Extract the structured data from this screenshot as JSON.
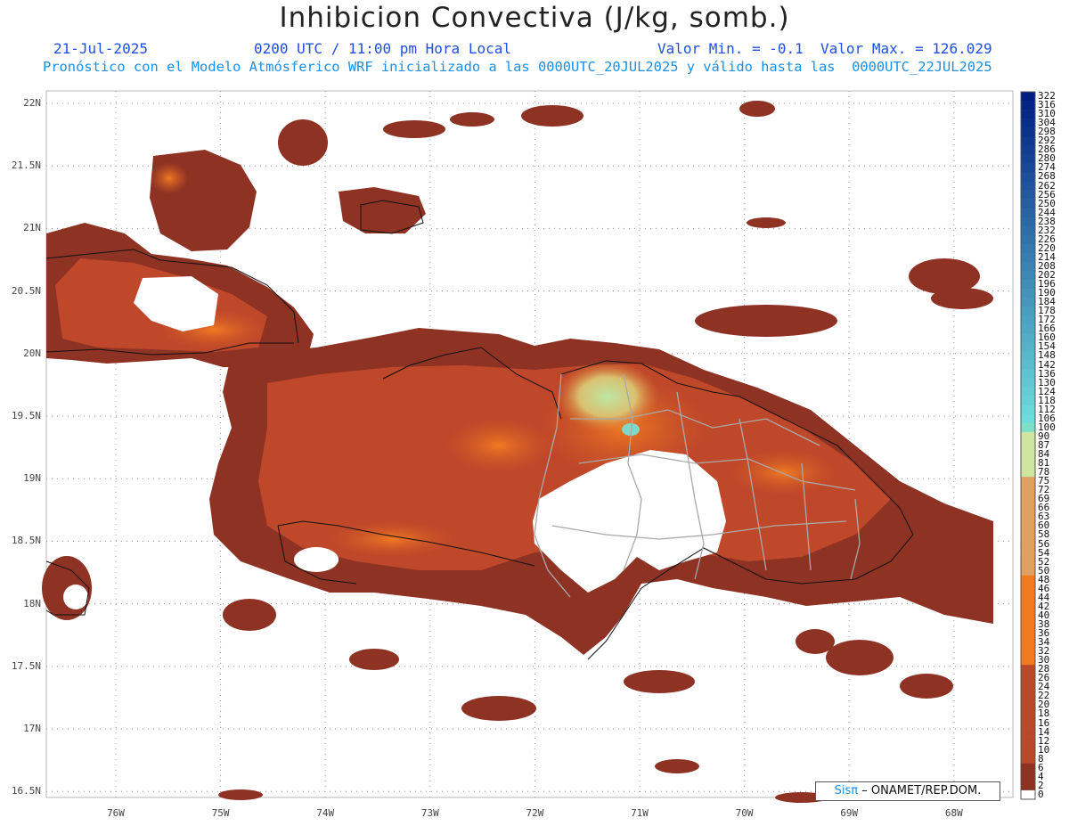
{
  "header": {
    "title": "Inhibicion Convectiva (J/kg, somb.)",
    "date": "21-Jul-2025",
    "time": "0200 UTC / 11:00 pm Hora Local",
    "min_max": "Valor Min. = -0.1  Valor Max. = 126.029",
    "forecast_info": "Pronóstico con el Modelo Atmósferico WRF inicializado a las 0000UTC_20JUL2025 y válido hasta las  0000UTC_22JUL2025"
  },
  "map": {
    "lat_labels": [
      "22N",
      "21.5N",
      "21N",
      "20.5N",
      "20N",
      "19.5N",
      "19N",
      "18.5N",
      "18N",
      "17.5N",
      "17N",
      "16.5N"
    ],
    "lon_labels": [
      "76W",
      "75W",
      "74W",
      "73W",
      "72W",
      "71W",
      "70W",
      "69W",
      "68W"
    ],
    "grid": true,
    "fill_colors": {
      "low": "#8e3224",
      "mid": "#cf5a26",
      "high": "#ef7a20",
      "peak": "#b8e39a",
      "max": "#7fd8c8"
    }
  },
  "colorbar": {
    "labels": [
      "322",
      "316",
      "310",
      "304",
      "298",
      "292",
      "286",
      "280",
      "274",
      "268",
      "262",
      "256",
      "250",
      "244",
      "238",
      "232",
      "226",
      "220",
      "214",
      "208",
      "202",
      "196",
      "190",
      "184",
      "178",
      "172",
      "166",
      "160",
      "154",
      "148",
      "142",
      "136",
      "130",
      "124",
      "118",
      "112",
      "106",
      "100",
      "90",
      "87",
      "84",
      "81",
      "78",
      "75",
      "72",
      "69",
      "66",
      "63",
      "60",
      "58",
      "56",
      "54",
      "52",
      "50",
      "48",
      "46",
      "44",
      "42",
      "40",
      "38",
      "36",
      "34",
      "32",
      "30",
      "28",
      "26",
      "24",
      "22",
      "20",
      "18",
      "16",
      "14",
      "12",
      "10",
      "8",
      "6",
      "4",
      "2",
      "0"
    ]
  },
  "credit": {
    "brand": "Sisπ",
    "text": "– ONAMET/REP.DOM."
  }
}
